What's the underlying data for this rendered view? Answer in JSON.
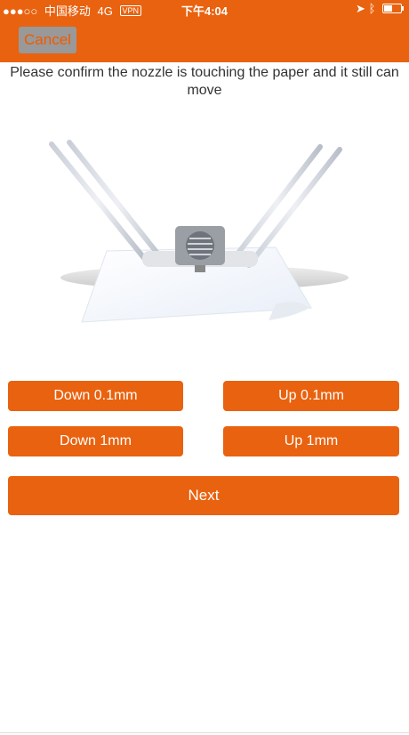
{
  "status_bar": {
    "signal": "●●●○○",
    "carrier": "中国移动",
    "network": "4G",
    "vpn": "VPN",
    "time": "下午4:04"
  },
  "header": {
    "cancel_label": "Cancel"
  },
  "instruction": "Please confirm the nozzle is touching the paper and it still can move",
  "buttons": {
    "down_small": "Down 0.1mm",
    "up_small": "Up 0.1mm",
    "down_large": "Down 1mm",
    "up_large": "Up 1mm",
    "next": "Next"
  },
  "colors": {
    "accent": "#e9620f",
    "cancel_bg": "#999999"
  }
}
